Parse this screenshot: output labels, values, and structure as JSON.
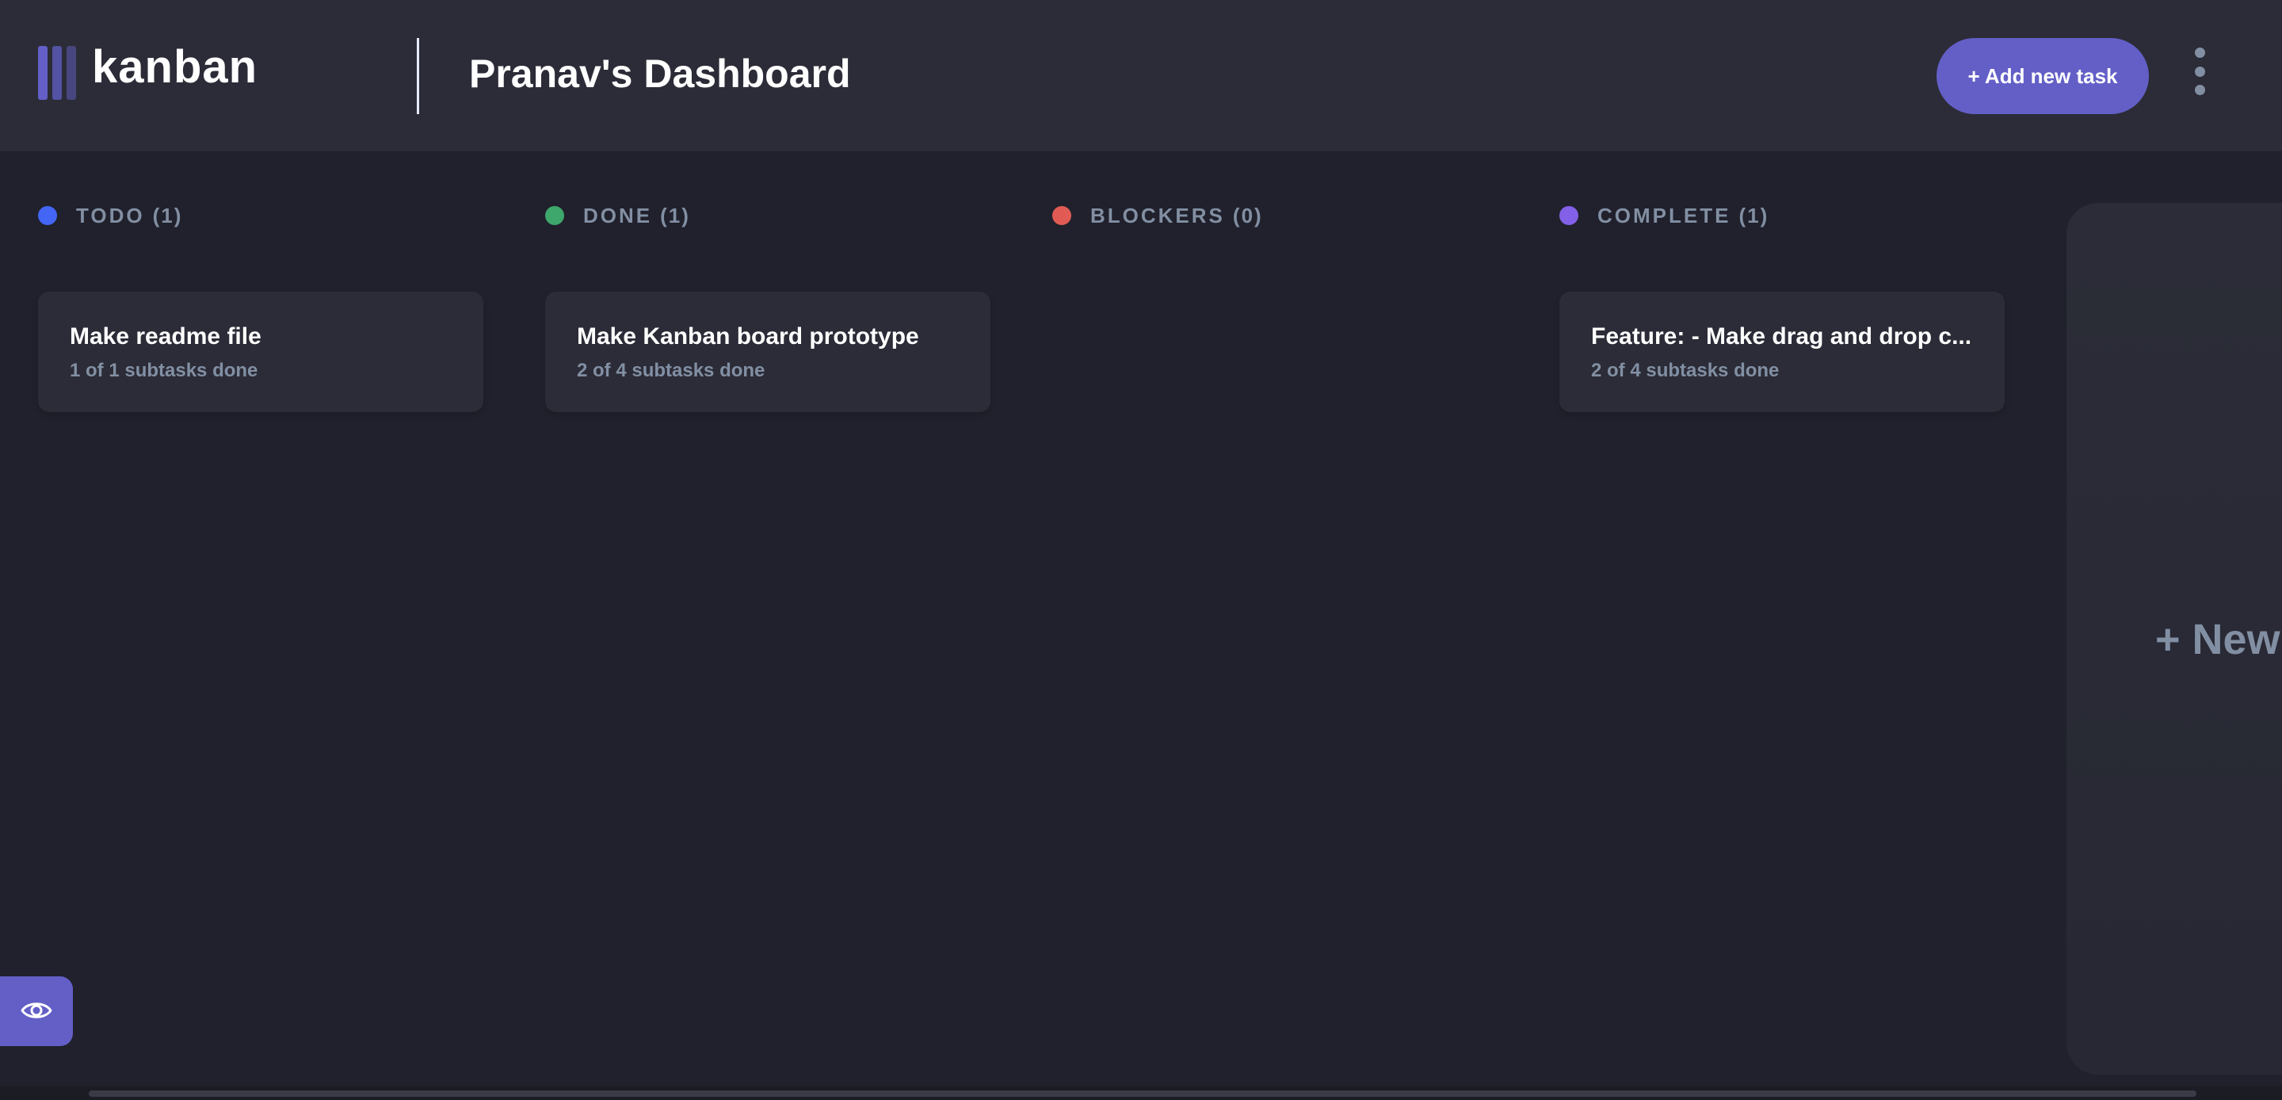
{
  "app": {
    "logo_text": "kanban"
  },
  "header": {
    "board_title": "Pranav's Dashboard",
    "add_task_label": "+ Add new task"
  },
  "columns": [
    {
      "name": "TODO",
      "count": "(1)",
      "dot_color": "#4366f6",
      "tasks": [
        {
          "title": "Make readme file",
          "subtasks": "1 of 1 subtasks done"
        }
      ]
    },
    {
      "name": "DONE",
      "count": "(1)",
      "dot_color": "#3ea76b",
      "tasks": [
        {
          "title": "Make Kanban board prototype",
          "subtasks": "2 of 4 subtasks done"
        }
      ]
    },
    {
      "name": "BLOCKERS",
      "count": "(0)",
      "dot_color": "#e15b54",
      "tasks": []
    },
    {
      "name": "COMPLETE",
      "count": "(1)",
      "dot_color": "#8360e8",
      "tasks": [
        {
          "title": "Feature: - Make drag and drop c...",
          "subtasks": "2 of 4 subtasks done"
        }
      ]
    }
  ],
  "new_column_label": "+ New Column",
  "colors": {
    "background": "#20212c",
    "surface": "#2b2c37",
    "accent": "#635fc7",
    "muted_text": "#828fa3"
  },
  "icons": {
    "logo": "kanban-logo-icon",
    "menu": "vertical-ellipsis-icon",
    "show_sidebar": "eye-icon"
  }
}
